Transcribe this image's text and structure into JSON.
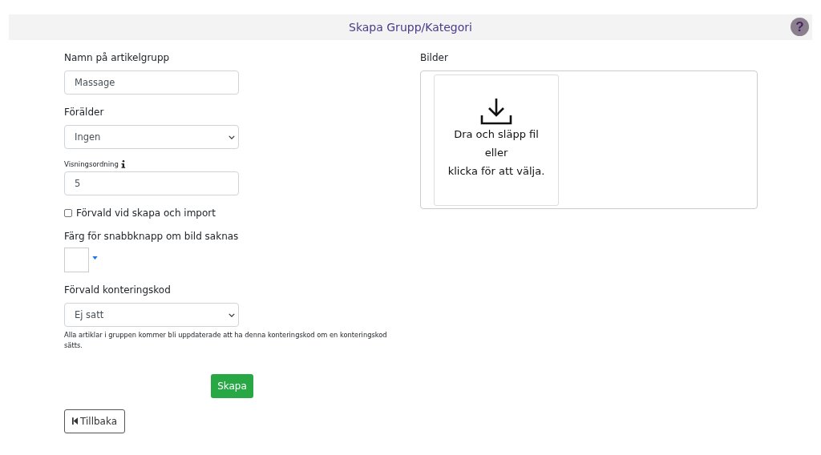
{
  "header": {
    "title": "Skapa Grupp/Kategori",
    "help": "?"
  },
  "form": {
    "name_label": "Namn på artikelgrupp",
    "name_value": "Massage",
    "parent_label": "Förälder",
    "parent_value": "Ingen",
    "order_label": "Visningsordning",
    "order_value": "5",
    "default_checkbox": {
      "label": "Förvald vid skapa och import",
      "checked": false
    },
    "color_label": "Färg för snabbknapp om bild saknas",
    "color": "#ffffff",
    "account_label": "Förvald konteringskod",
    "account_value": "Ej satt",
    "account_help": "Alla artiklar i gruppen kommer bli uppdaterade att ha denna konteringskod om en konteringskod sätts.",
    "submit": "Skapa",
    "back": "Tillbaka"
  },
  "images": {
    "label": "Bilder",
    "dropzone_lines": [
      "Dra och släpp fil",
      "eller",
      "klicka för att välja."
    ]
  }
}
